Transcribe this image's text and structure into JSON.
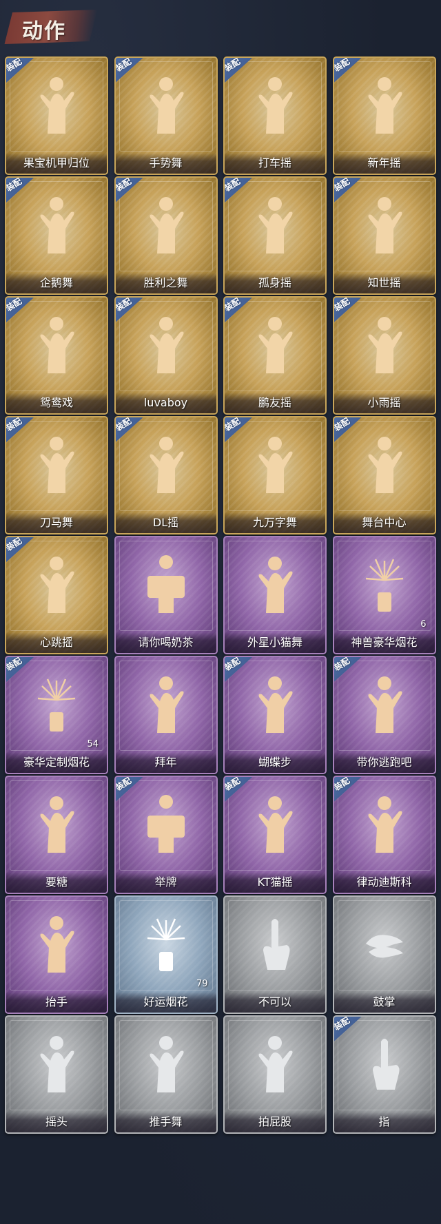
{
  "header": {
    "title": "动作"
  },
  "equip_label": "装配",
  "actions": [
    {
      "name": "果宝机甲归位",
      "tier": "gold",
      "equipped": true,
      "count": null,
      "icon": "dancer-icon"
    },
    {
      "name": "手势舞",
      "tier": "gold",
      "equipped": true,
      "count": null,
      "icon": "dancer-icon"
    },
    {
      "name": "打车摇",
      "tier": "gold",
      "equipped": true,
      "count": null,
      "icon": "dancer-icon"
    },
    {
      "name": "新年摇",
      "tier": "gold",
      "equipped": true,
      "count": null,
      "icon": "dancer-icon"
    },
    {
      "name": "企鹅舞",
      "tier": "gold",
      "equipped": true,
      "count": null,
      "icon": "dancer-icon"
    },
    {
      "name": "胜利之舞",
      "tier": "gold",
      "equipped": true,
      "count": null,
      "icon": "dancer-icon"
    },
    {
      "name": "孤身摇",
      "tier": "gold",
      "equipped": true,
      "count": null,
      "icon": "dancer-icon"
    },
    {
      "name": "知世摇",
      "tier": "gold",
      "equipped": true,
      "count": null,
      "icon": "dancer-icon"
    },
    {
      "name": "鸳鸯戏",
      "tier": "gold",
      "equipped": true,
      "count": null,
      "icon": "dancer-icon"
    },
    {
      "name": "luvaboy",
      "tier": "gold",
      "equipped": true,
      "count": null,
      "icon": "dancer-icon"
    },
    {
      "name": "鹏友摇",
      "tier": "gold",
      "equipped": true,
      "count": null,
      "icon": "dancer-icon"
    },
    {
      "name": "小雨摇",
      "tier": "gold",
      "equipped": true,
      "count": null,
      "icon": "dancer-icon"
    },
    {
      "name": "刀马舞",
      "tier": "gold",
      "equipped": true,
      "count": null,
      "icon": "dancer-icon"
    },
    {
      "name": "DL摇",
      "tier": "gold",
      "equipped": true,
      "count": null,
      "icon": "dancer-icon"
    },
    {
      "name": "九万字舞",
      "tier": "gold",
      "equipped": true,
      "count": null,
      "icon": "dancer-icon"
    },
    {
      "name": "舞台中心",
      "tier": "gold",
      "equipped": true,
      "count": null,
      "icon": "dancer-icon"
    },
    {
      "name": "心跳摇",
      "tier": "gold",
      "equipped": true,
      "count": null,
      "icon": "dancer-icon"
    },
    {
      "name": "请你喝奶茶",
      "tier": "purple",
      "equipped": false,
      "count": null,
      "icon": "sign-icon"
    },
    {
      "name": "外星小猫舞",
      "tier": "purple",
      "equipped": false,
      "count": null,
      "icon": "dancer-icon"
    },
    {
      "name": "神兽豪华烟花",
      "tier": "purple",
      "equipped": false,
      "count": "6",
      "icon": "fireworks-icon"
    },
    {
      "name": "豪华定制烟花",
      "tier": "purple",
      "equipped": true,
      "count": "54",
      "icon": "fireworks-icon"
    },
    {
      "name": "拜年",
      "tier": "purple",
      "equipped": false,
      "count": null,
      "icon": "dancer-icon"
    },
    {
      "name": "蝴蝶步",
      "tier": "purple",
      "equipped": true,
      "count": null,
      "icon": "dancer-icon"
    },
    {
      "name": "带你逃跑吧",
      "tier": "purple",
      "equipped": true,
      "count": null,
      "icon": "dancer-icon"
    },
    {
      "name": "要糖",
      "tier": "purple",
      "equipped": false,
      "count": null,
      "icon": "dancer-icon"
    },
    {
      "name": "举牌",
      "tier": "purple",
      "equipped": true,
      "count": null,
      "icon": "sign-icon"
    },
    {
      "name": "KT猫摇",
      "tier": "purple",
      "equipped": true,
      "count": null,
      "icon": "dancer-icon"
    },
    {
      "name": "律动迪斯科",
      "tier": "purple",
      "equipped": true,
      "count": null,
      "icon": "dancer-icon"
    },
    {
      "name": "抬手",
      "tier": "purple",
      "equipped": false,
      "count": null,
      "icon": "dancer-icon"
    },
    {
      "name": "好运烟花",
      "tier": "blue",
      "equipped": false,
      "count": "79",
      "icon": "fireworks-icon"
    },
    {
      "name": "不可以",
      "tier": "gray",
      "equipped": false,
      "count": null,
      "icon": "finger-icon"
    },
    {
      "name": "鼓掌",
      "tier": "gray",
      "equipped": false,
      "count": null,
      "icon": "clap-icon"
    },
    {
      "name": "摇头",
      "tier": "gray",
      "equipped": false,
      "count": null,
      "icon": "dancer-icon"
    },
    {
      "name": "推手舞",
      "tier": "gray",
      "equipped": false,
      "count": null,
      "icon": "dancer-icon"
    },
    {
      "name": "拍屁股",
      "tier": "gray",
      "equipped": false,
      "count": null,
      "icon": "dancer-icon"
    },
    {
      "name": "指",
      "tier": "gray",
      "equipped": true,
      "count": null,
      "icon": "finger-icon"
    }
  ],
  "colors": {
    "background": "#1b2230",
    "gold_tier": "#c7a25a",
    "purple_tier": "#9066a8",
    "blue_tier": "#8fa6bc",
    "gray_tier": "#9a9da0",
    "equip_badge": "#3a5486"
  }
}
